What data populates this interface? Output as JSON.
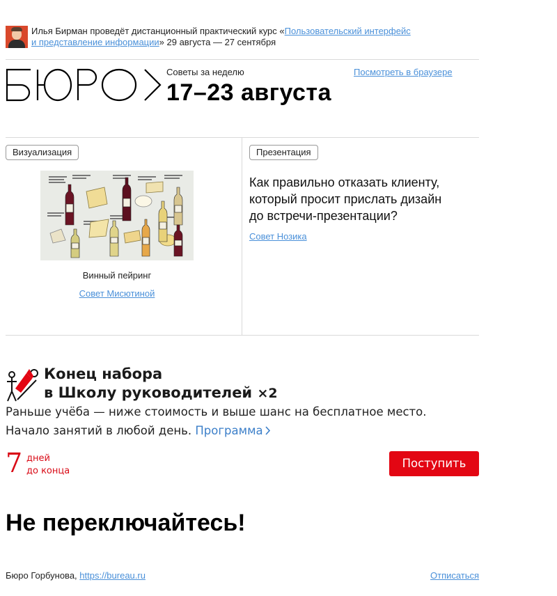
{
  "announcement": {
    "prefix": "Илья Бирман проведёт дистанционный практический курс «",
    "course_line1": "Пользовательский интерфейс",
    "course_line2": "и представление информации",
    "suffix": "» 29 августа — 27 сентября"
  },
  "header": {
    "logo": "БЮРО",
    "subtitle": "Советы за неделю",
    "date_range": "17–23 августа",
    "browser_link": "Посмотреть в браузере"
  },
  "tips": [
    {
      "category": "Визуализация",
      "caption": "Винный пейринг",
      "link": "Совет Мисютиной"
    },
    {
      "category": "Презентация",
      "question": "Как правильно отказать клиенту, который просит прислать дизайн до встречи-презентации?",
      "link": "Совет Нозика"
    }
  ],
  "promo": {
    "title_line1": "Конец набора",
    "title_line2": "в Школу руководителей",
    "title_badge": "×2",
    "line1": "Раньше учёба — ниже стоимость и выше шанс на бесплатное место.",
    "line2": "Начало занятий в любой день.",
    "program_link": "Программа",
    "days_number": "7",
    "days_word": "дней",
    "days_until": "до конца",
    "enroll_button": "Поступить"
  },
  "closing": {
    "headline": "Не переключайтесь!"
  },
  "footer": {
    "company": "Бюро Горбунова,",
    "site_link": "https://bureau.ru",
    "unsubscribe": "Отписаться"
  },
  "colors": {
    "accent_red": "#e30613",
    "link_blue": "#4a90d9",
    "divider": "#d9d9d9"
  }
}
